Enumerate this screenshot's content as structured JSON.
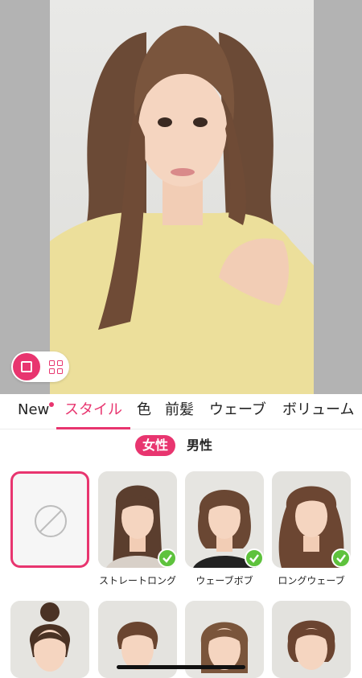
{
  "tabs": [
    {
      "label": "New",
      "active": false,
      "has_dot": true
    },
    {
      "label": "スタイル",
      "active": true
    },
    {
      "label": "色",
      "active": false
    },
    {
      "label": "前髪",
      "active": false
    },
    {
      "label": "ウェーブ",
      "active": false
    },
    {
      "label": "ボリューム",
      "active": false
    }
  ],
  "gender": {
    "female": "女性",
    "male": "男性",
    "selected": "female"
  },
  "styles": [
    {
      "label": "ストレートロング",
      "checked": true
    },
    {
      "label": "ウェーブボブ",
      "checked": true
    },
    {
      "label": "ロングウェーブ",
      "checked": true
    }
  ],
  "colors": {
    "accent": "#e8356f",
    "check": "#5ec23d"
  },
  "icons": {
    "view_single": "square-icon",
    "view_grid": "grid-icon",
    "none": "no-style-icon",
    "check": "checkmark-icon"
  }
}
